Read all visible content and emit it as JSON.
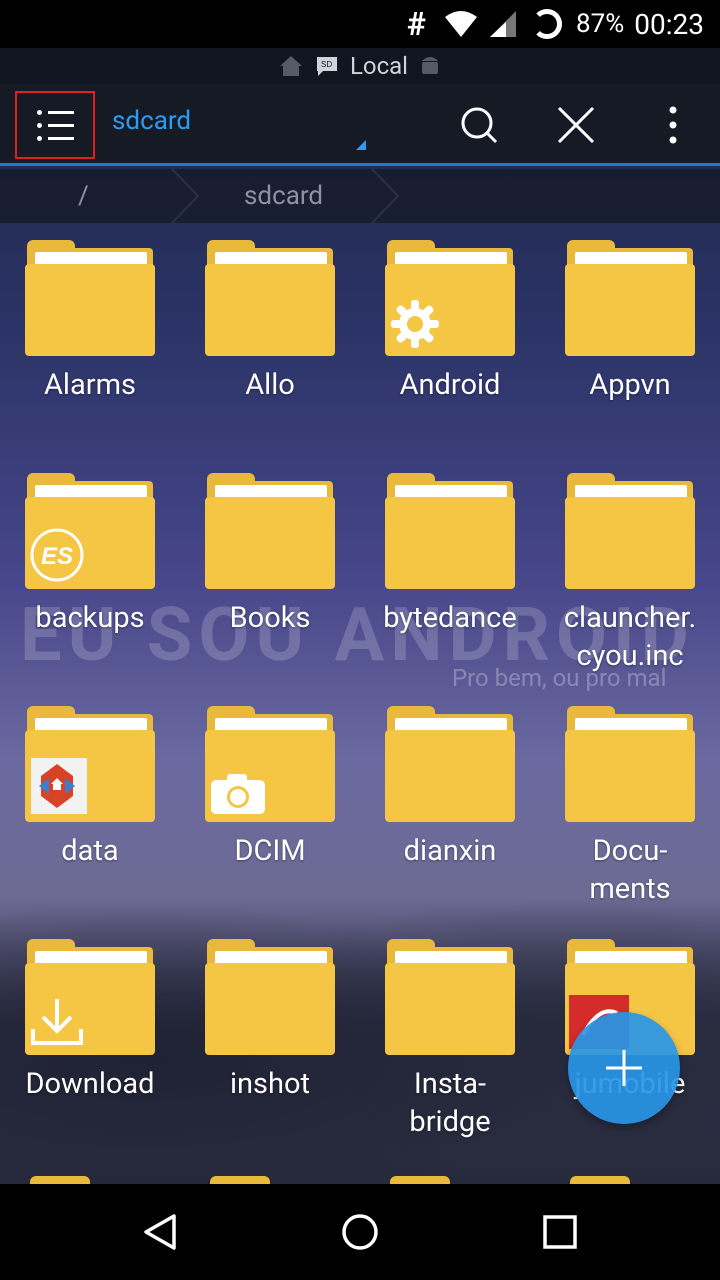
{
  "status_bar": {
    "hash_icon": "#",
    "battery": "87%",
    "time": "00:23"
  },
  "source_bar": {
    "label": "Local"
  },
  "app_bar": {
    "title": "sdcard",
    "menu_icon": "hamburger-menu-icon",
    "search_icon": "search-icon",
    "close_icon": "close-icon",
    "more_icon": "more-vert-icon"
  },
  "breadcrumb": {
    "root": "/",
    "current": "sdcard"
  },
  "folders": [
    {
      "label": "Alarms",
      "badge": ""
    },
    {
      "label": "Allo",
      "badge": ""
    },
    {
      "label": "Android",
      "badge": "gear-icon"
    },
    {
      "label": "Appvn",
      "badge": ""
    },
    {
      "label": "backups",
      "badge": "es-logo-icon"
    },
    {
      "label": "Books",
      "badge": ""
    },
    {
      "label": "bytedance",
      "badge": ""
    },
    {
      "label": "clauncher.\ncyou.inc",
      "badge": ""
    },
    {
      "label": "data",
      "badge": "nova-launcher-icon"
    },
    {
      "label": "DCIM",
      "badge": "camera-icon"
    },
    {
      "label": "dianxin",
      "badge": ""
    },
    {
      "label": "Docu-\nments",
      "badge": ""
    },
    {
      "label": "Download",
      "badge": "download-icon"
    },
    {
      "label": "inshot",
      "badge": ""
    },
    {
      "label": "Insta-\nbridge",
      "badge": ""
    },
    {
      "label": "jumobile",
      "badge": "app-icon"
    }
  ],
  "watermark": {
    "text": "EU SOU ANDROID",
    "subtitle": "Pro bem, ou pro mal"
  },
  "fab": {
    "icon": "plus-icon"
  },
  "nav_bar": {
    "back_icon": "back-triangle-icon",
    "home_icon": "home-circle-icon",
    "recents_icon": "recents-square-icon"
  },
  "colors": {
    "accent": "#2d9cf0",
    "folder": "#f5c544",
    "highlight_border": "#e02020"
  }
}
